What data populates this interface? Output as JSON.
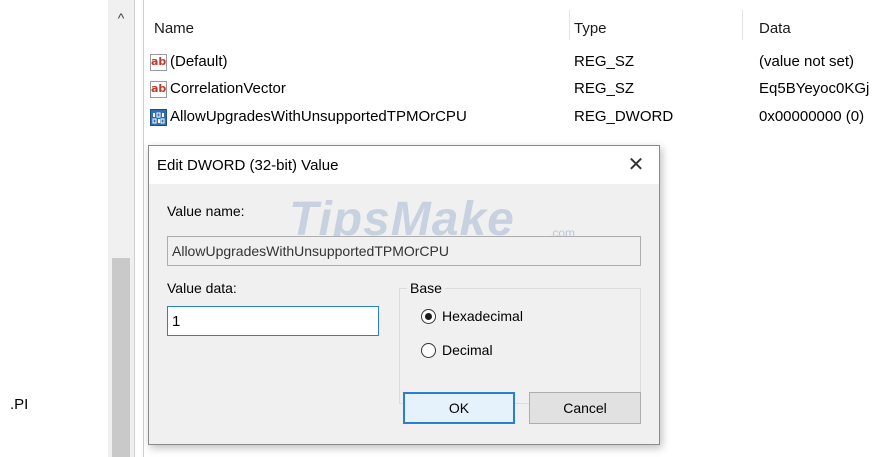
{
  "tree": {
    "visible_fragment": ".PI"
  },
  "scrollbar": {
    "up_arrow": "^"
  },
  "list": {
    "columns": {
      "name": "Name",
      "type": "Type",
      "data": "Data"
    },
    "rows": [
      {
        "icon": "string-value-icon",
        "name": "(Default)",
        "type": "REG_SZ",
        "data": "(value not set)"
      },
      {
        "icon": "string-value-icon",
        "name": "CorrelationVector",
        "type": "REG_SZ",
        "data": "Eq5BYeyoc0KGj"
      },
      {
        "icon": "binary-value-icon",
        "name": "AllowUpgradesWithUnsupportedTPMOrCPU",
        "type": "REG_DWORD",
        "data": "0x00000000 (0)"
      }
    ],
    "string_icon_glyph": "ab"
  },
  "dialog": {
    "title": "Edit DWORD (32-bit) Value",
    "close_glyph": "✕",
    "value_name_label": "Value name:",
    "value_name": "AllowUpgradesWithUnsupportedTPMOrCPU",
    "value_data_label": "Value data:",
    "value_data": "1",
    "base_label": "Base",
    "base_options": [
      {
        "label": "Hexadecimal",
        "selected": true
      },
      {
        "label": "Decimal",
        "selected": false
      }
    ],
    "ok_label": "OK",
    "cancel_label": "Cancel"
  },
  "watermark": {
    "text": "TipsMake",
    "suffix": ".com"
  },
  "colors": {
    "focus_blue": "#2a7fd1",
    "dialog_body": "#f0f0f0",
    "dword_icon": "#2e6fb5"
  }
}
